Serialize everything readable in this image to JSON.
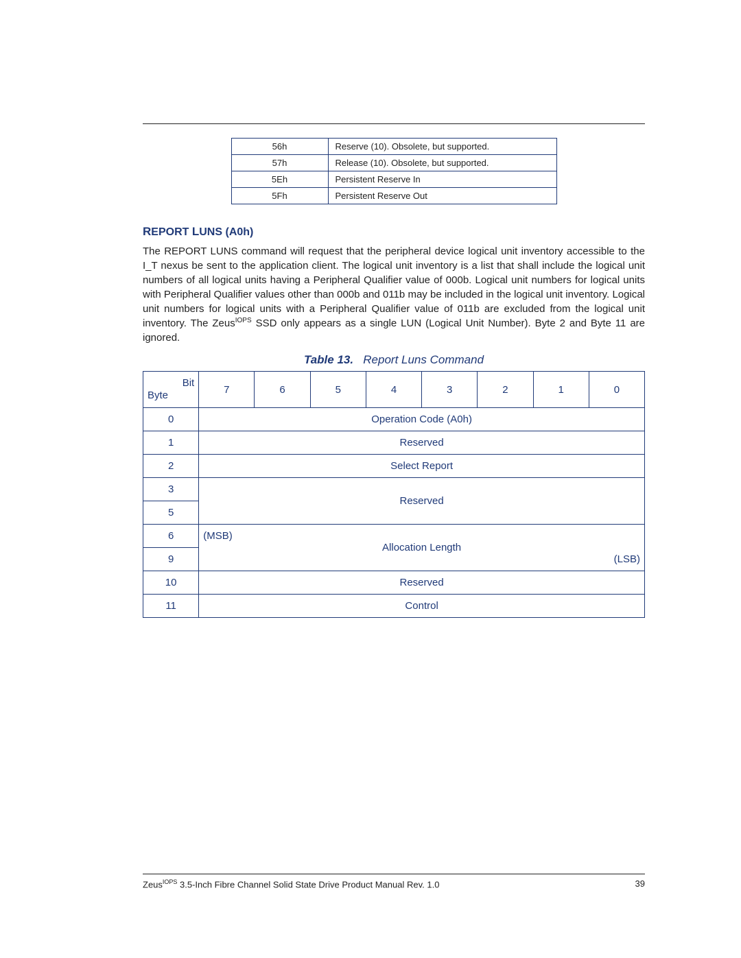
{
  "topTable": {
    "rows": [
      {
        "code": "56h",
        "desc": "Reserve (10). Obsolete, but supported."
      },
      {
        "code": "57h",
        "desc": "Release (10). Obsolete, but supported."
      },
      {
        "code": "5Eh",
        "desc": "Persistent Reserve In"
      },
      {
        "code": "5Fh",
        "desc": "Persistent Reserve Out"
      }
    ]
  },
  "section": {
    "heading_pre": "R",
    "heading_word1_rest": "EPORT",
    "heading_word2_first": "L",
    "heading_word2_rest": "UNS",
    "heading_suffix": "(A0h)",
    "paragraph_part1": "The REPORT LUNS command will request that the peripheral device logical unit inventory accessible to the I_T nexus be sent to the application client. The logical unit inventory is a list that shall include the logical unit numbers of all logical units having a Peripheral Qualifier value of 000b. Logical unit numbers for logical units with Peripheral Qualifier values other than 000b and 011b may be included in the logical unit inventory. Logical unit numbers for logical units with a Peripheral Qualifier value of 011b are excluded from the logical unit inventory. The Zeus",
    "paragraph_sup": "IOPS",
    "paragraph_part2": " SSD only appears as a single LUN (Logical Unit Number). Byte 2 and Byte 11 are ignored."
  },
  "cmdTable": {
    "caption_label": "Table 13.",
    "caption_title": "Report Luns Command",
    "header": {
      "bit": "Bit",
      "byte": "Byte",
      "bits": [
        "7",
        "6",
        "5",
        "4",
        "3",
        "2",
        "1",
        "0"
      ]
    },
    "rows": {
      "r0": {
        "byte": "0",
        "label": "Operation Code (A0h)"
      },
      "r1": {
        "byte": "1",
        "label": "Reserved"
      },
      "r2": {
        "byte": "2",
        "label": "Select Report"
      },
      "r35": {
        "byte_top": "3",
        "byte_bot": "5",
        "label": "Reserved"
      },
      "r69": {
        "byte_top": "6",
        "byte_bot": "9",
        "msb": "(MSB)",
        "label": "Allocation Length",
        "lsb": "(LSB)"
      },
      "r10": {
        "byte": "10",
        "label": "Reserved"
      },
      "r11": {
        "byte": "11",
        "label": "Control"
      }
    }
  },
  "footer": {
    "text_pre": "Zeus",
    "text_sup": "IOPS",
    "text_post": " 3.5-Inch Fibre Channel Solid State Drive Product Manual Rev. 1.0",
    "page": "39"
  }
}
